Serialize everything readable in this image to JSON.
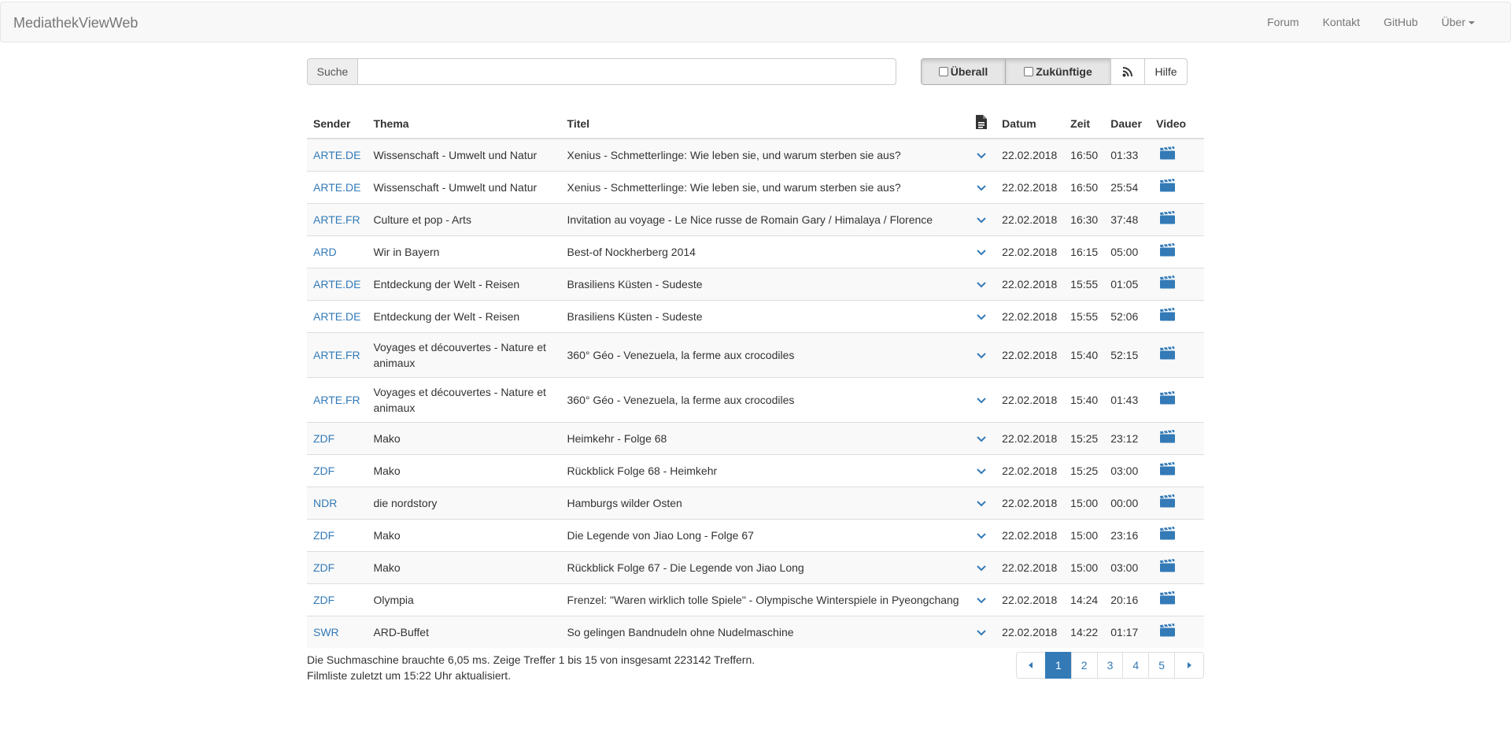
{
  "navbar": {
    "brand": "MediathekViewWeb",
    "links": [
      "Forum",
      "Kontakt",
      "GitHub"
    ],
    "dropdown_label": "Über"
  },
  "search": {
    "addon_label": "Suche",
    "value": "",
    "placeholder": ""
  },
  "buttons": {
    "everywhere": "Überall",
    "future": "Zukünftige",
    "rss_icon": "rss-icon",
    "help": "Hilfe"
  },
  "table": {
    "headers": {
      "sender": "Sender",
      "thema": "Thema",
      "titel": "Titel",
      "desc_icon": "document-icon",
      "datum": "Datum",
      "zeit": "Zeit",
      "dauer": "Dauer",
      "video": "Video"
    },
    "rows": [
      {
        "sender": "ARTE.DE",
        "thema": "Wissenschaft - Umwelt und Natur",
        "titel": "Xenius - Schmetterlinge: Wie leben sie, und warum sterben sie aus?",
        "datum": "22.02.2018",
        "zeit": "16:50",
        "dauer": "01:33"
      },
      {
        "sender": "ARTE.DE",
        "thema": "Wissenschaft - Umwelt und Natur",
        "titel": "Xenius - Schmetterlinge: Wie leben sie, und warum sterben sie aus?",
        "datum": "22.02.2018",
        "zeit": "16:50",
        "dauer": "25:54"
      },
      {
        "sender": "ARTE.FR",
        "thema": "Culture et pop - Arts",
        "titel": "Invitation au voyage - Le Nice russe de Romain Gary / Himalaya / Florence",
        "datum": "22.02.2018",
        "zeit": "16:30",
        "dauer": "37:48"
      },
      {
        "sender": "ARD",
        "thema": "Wir in Bayern",
        "titel": "Best-of Nockherberg 2014",
        "datum": "22.02.2018",
        "zeit": "16:15",
        "dauer": "05:00"
      },
      {
        "sender": "ARTE.DE",
        "thema": "Entdeckung der Welt - Reisen",
        "titel": "Brasiliens Küsten - Sudeste",
        "datum": "22.02.2018",
        "zeit": "15:55",
        "dauer": "01:05"
      },
      {
        "sender": "ARTE.DE",
        "thema": "Entdeckung der Welt - Reisen",
        "titel": "Brasiliens Küsten - Sudeste",
        "datum": "22.02.2018",
        "zeit": "15:55",
        "dauer": "52:06"
      },
      {
        "sender": "ARTE.FR",
        "thema": "Voyages et découvertes - Nature et animaux",
        "titel": "360° Géo - Venezuela, la ferme aux crocodiles",
        "datum": "22.02.2018",
        "zeit": "15:40",
        "dauer": "52:15"
      },
      {
        "sender": "ARTE.FR",
        "thema": "Voyages et découvertes - Nature et animaux",
        "titel": "360° Géo - Venezuela, la ferme aux crocodiles",
        "datum": "22.02.2018",
        "zeit": "15:40",
        "dauer": "01:43"
      },
      {
        "sender": "ZDF",
        "thema": "Mako",
        "titel": "Heimkehr - Folge 68",
        "datum": "22.02.2018",
        "zeit": "15:25",
        "dauer": "23:12"
      },
      {
        "sender": "ZDF",
        "thema": "Mako",
        "titel": "Rückblick Folge 68 - Heimkehr",
        "datum": "22.02.2018",
        "zeit": "15:25",
        "dauer": "03:00"
      },
      {
        "sender": "NDR",
        "thema": "die nordstory",
        "titel": "Hamburgs wilder Osten",
        "datum": "22.02.2018",
        "zeit": "15:00",
        "dauer": "00:00"
      },
      {
        "sender": "ZDF",
        "thema": "Mako",
        "titel": "Die Legende von Jiao Long - Folge 67",
        "datum": "22.02.2018",
        "zeit": "15:00",
        "dauer": "23:16"
      },
      {
        "sender": "ZDF",
        "thema": "Mako",
        "titel": "Rückblick Folge 67 - Die Legende von Jiao Long",
        "datum": "22.02.2018",
        "zeit": "15:00",
        "dauer": "03:00"
      },
      {
        "sender": "ZDF",
        "thema": "Olympia",
        "titel": "Frenzel: \"Waren wirklich tolle Spiele\" - Olympische Winterspiele in Pyeongchang",
        "datum": "22.02.2018",
        "zeit": "14:24",
        "dauer": "20:16"
      },
      {
        "sender": "SWR",
        "thema": "ARD-Buffet",
        "titel": "So gelingen Bandnudeln ohne Nudelmaschine",
        "datum": "22.02.2018",
        "zeit": "14:22",
        "dauer": "01:17"
      }
    ]
  },
  "footer": {
    "info_line1": "Die Suchmaschine brauchte 6,05 ms. Zeige Treffer 1 bis 15 von insgesamt 223142 Treffern.",
    "info_line2": "Filmliste zuletzt um 15:22 Uhr aktualisiert."
  },
  "pagination": {
    "pages": [
      "1",
      "2",
      "3",
      "4",
      "5"
    ],
    "active_page": "1",
    "prev_icon": "triangle-left-icon",
    "next_icon": "triangle-right-icon"
  },
  "colors": {
    "link": "#337ab7",
    "navbar_bg": "#f8f8f8",
    "stripe": "#f9f9f9"
  }
}
